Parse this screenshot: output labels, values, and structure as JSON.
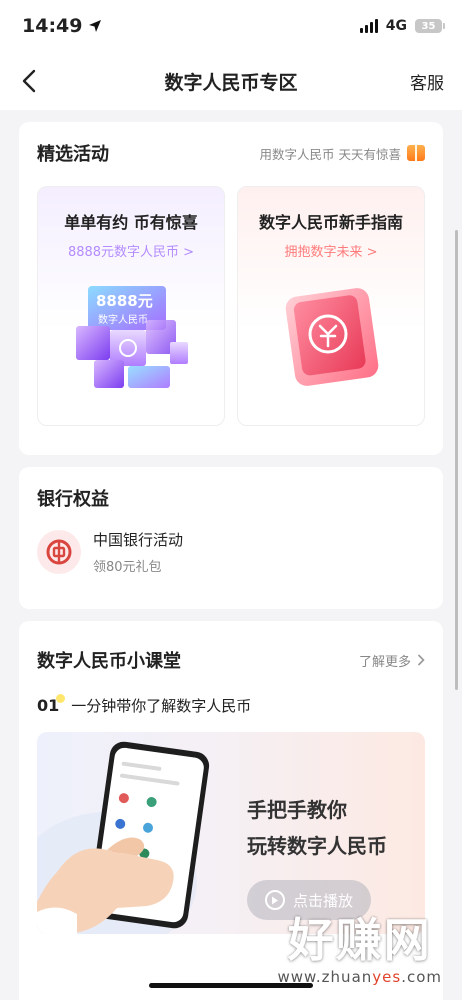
{
  "status_bar": {
    "time": "14:49",
    "network": "4G",
    "battery": "35"
  },
  "nav": {
    "title": "数字人民币专区",
    "service_label": "客服"
  },
  "activities": {
    "title": "精选活动",
    "subtitle": "用数字人民币 天天有惊喜",
    "tiles": [
      {
        "title": "单单有约 币有惊喜",
        "subtitle": "8888元数字人民币 >",
        "art_text_1": "8888元",
        "art_text_2": "数字人民币"
      },
      {
        "title": "数字人民币新手指南",
        "subtitle": "拥抱数字未来 >"
      }
    ]
  },
  "bank": {
    "title": "银行权益",
    "item": {
      "name": "中国银行活动",
      "desc": "领80元礼包"
    }
  },
  "classroom": {
    "title": "数字人民币小课堂",
    "more_label": "了解更多",
    "lesson": {
      "number": "01",
      "text": "一分钟带你了解数字人民币"
    },
    "video": {
      "title_line1": "手把手教你",
      "title_line2": "玩转数字人民币",
      "play_label": "点击播放"
    }
  },
  "watermark": {
    "main": "好赚网",
    "url_prefix": "www.zhuan",
    "url_accent": "yes",
    "url_suffix": ".com"
  },
  "colors": {
    "accent_purple": "#b38cff",
    "accent_red": "#ff7b7b",
    "bank_red": "#d9463f"
  },
  "icons": {
    "back": "chevron-left-icon",
    "location": "location-arrow-icon",
    "gift": "gift-icon",
    "more": "chevron-right-icon",
    "play": "play-icon"
  }
}
